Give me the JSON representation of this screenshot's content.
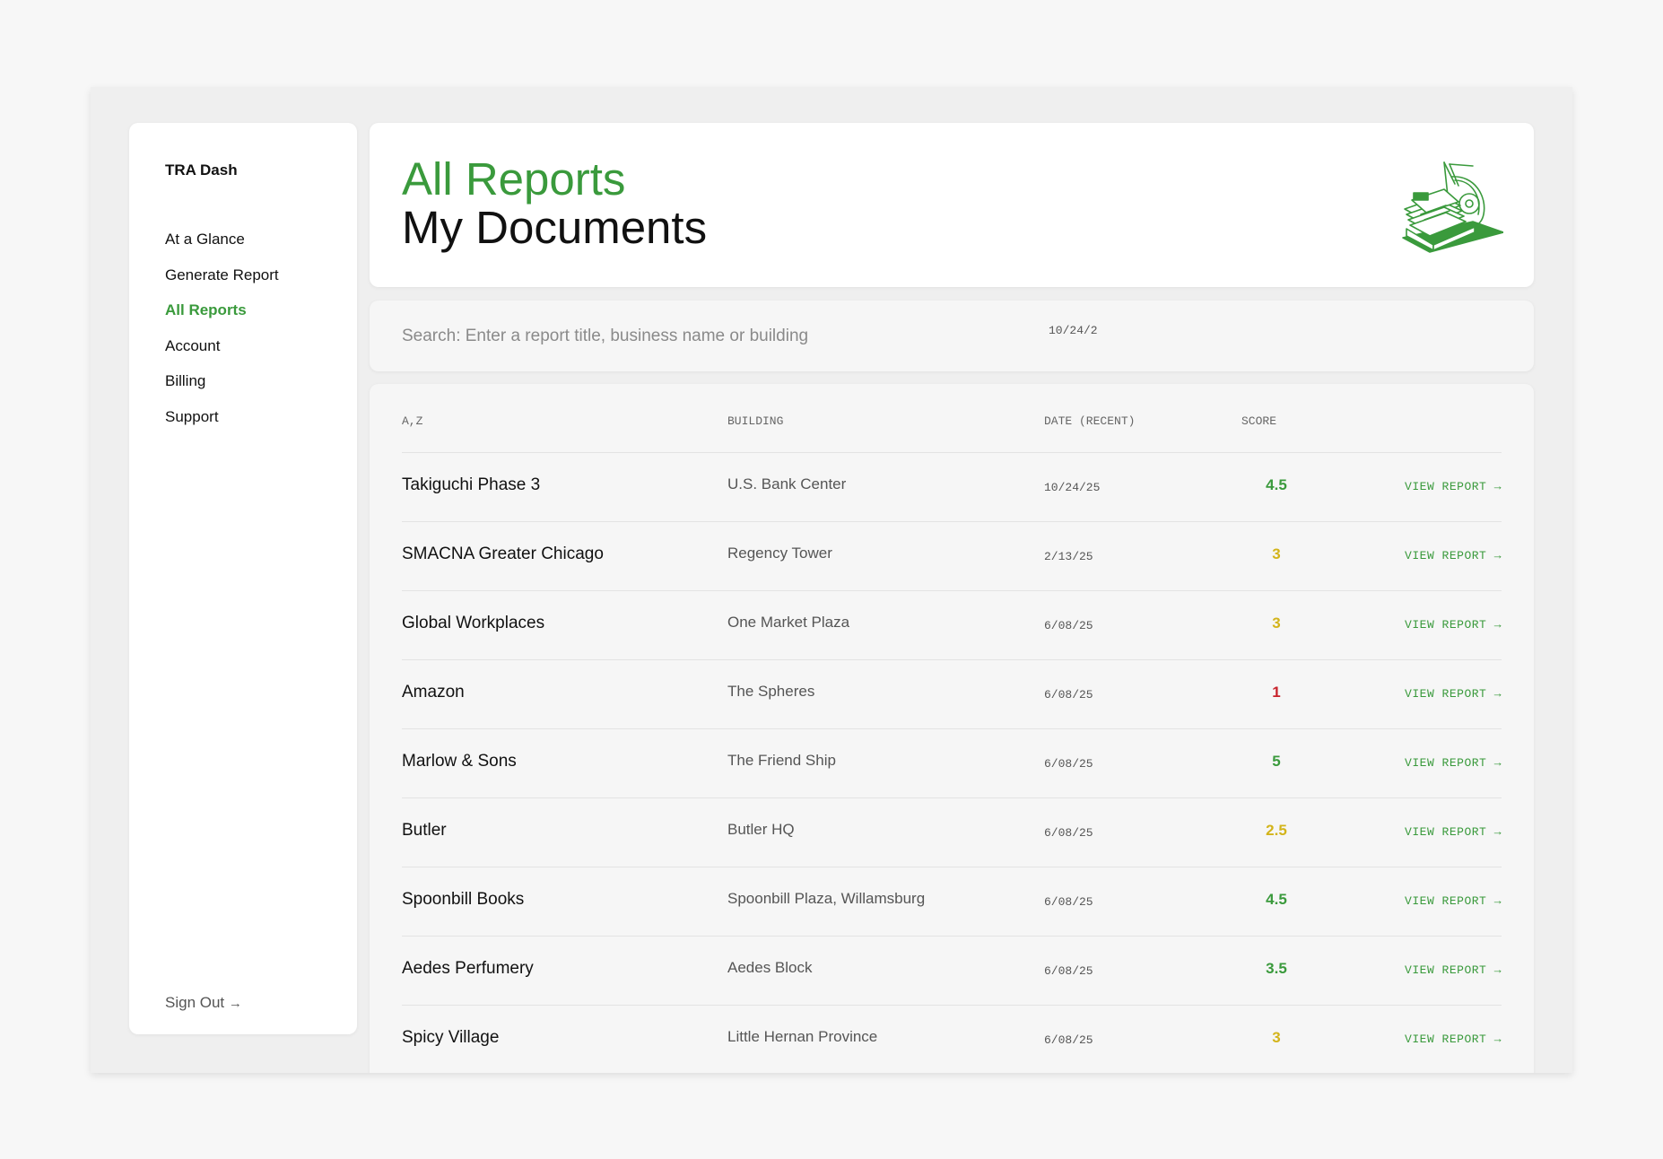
{
  "sidebar": {
    "brand": "TRA Dash",
    "nav": [
      {
        "label": "At a Glance",
        "name": "nav-at-a-glance",
        "active": false
      },
      {
        "label": "Generate Report",
        "name": "nav-generate-report",
        "active": false
      },
      {
        "label": "All Reports",
        "name": "nav-all-reports",
        "active": true
      },
      {
        "label": "Account",
        "name": "nav-account",
        "active": false
      },
      {
        "label": "Billing",
        "name": "nav-billing",
        "active": false
      },
      {
        "label": "Support",
        "name": "nav-support",
        "active": false
      }
    ],
    "sign_out": "Sign Out",
    "sign_out_icon": "arrow-right-icon"
  },
  "header": {
    "title": "All Reports",
    "subtitle": "My Documents",
    "illustration_icon": "rolodex-icon"
  },
  "search": {
    "placeholder": "Search: Enter a report title, business name or building",
    "value": "",
    "date_text": "10/24/2"
  },
  "table": {
    "columns": {
      "title": "A,Z",
      "building": "BUILDING",
      "date": "DATE (RECENT)",
      "score": "SCORE"
    },
    "link_label": "VIEW REPORT",
    "link_icon": "arrow-right-icon",
    "rows": [
      {
        "title": "Takiguchi Phase 3",
        "building": "U.S. Bank Center",
        "date": "10/24/25",
        "score": "4.5",
        "status": "good"
      },
      {
        "title": "SMACNA Greater Chicago",
        "building": "Regency Tower",
        "date": "2/13/25",
        "score": "3",
        "status": "fair"
      },
      {
        "title": "Global Workplaces",
        "building": "One Market Plaza",
        "date": "6/08/25",
        "score": "3",
        "status": "fair"
      },
      {
        "title": "Amazon",
        "building": "The Spheres",
        "date": "6/08/25",
        "score": "1",
        "status": "poor"
      },
      {
        "title": "Marlow & Sons",
        "building": "The Friend Ship",
        "date": "6/08/25",
        "score": "5",
        "status": "good"
      },
      {
        "title": "Butler",
        "building": "Butler HQ",
        "date": "6/08/25",
        "score": "2.5",
        "status": "fair"
      },
      {
        "title": "Spoonbill Books",
        "building": "Spoonbill Plaza, Willamsburg",
        "date": "6/08/25",
        "score": "4.5",
        "status": "good"
      },
      {
        "title": "Aedes Perfumery",
        "building": "Aedes Block",
        "date": "6/08/25",
        "score": "3.5",
        "status": "good"
      },
      {
        "title": "Spicy Village",
        "building": "Little Hernan Province",
        "date": "6/08/25",
        "score": "3",
        "status": "fair"
      }
    ]
  },
  "colors": {
    "accent": "#3a9a3c",
    "score_good": "#3a9a3c",
    "score_fair": "#d3b41a",
    "score_poor": "#c8232c"
  }
}
